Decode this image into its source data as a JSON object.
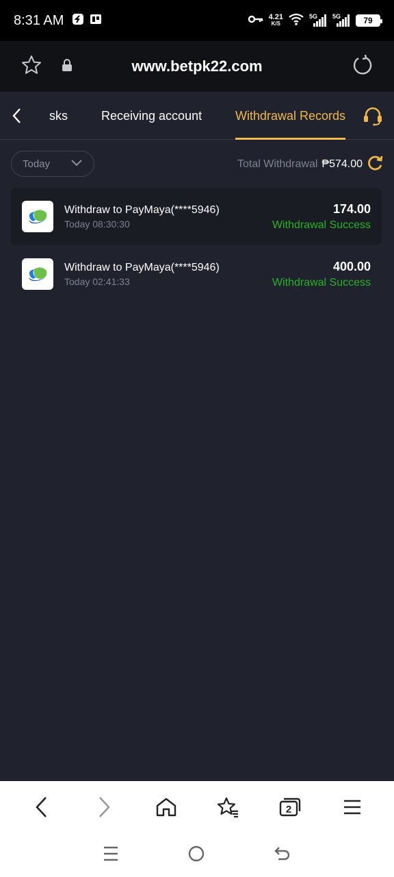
{
  "status": {
    "time": "8:31 AM",
    "speed_value": "4.21",
    "speed_unit": "K/S",
    "sim1": "5G",
    "sim2": "5G",
    "battery": "79"
  },
  "browser": {
    "url": "www.betpk22.com",
    "icons": [
      "star-icon",
      "lock-icon",
      "reload-icon"
    ]
  },
  "tabs": {
    "items": [
      "sks",
      "Receiving account",
      "Withdrawal Records"
    ],
    "active": "Withdrawal Records"
  },
  "filter": {
    "period": "Today",
    "total_label": "Total Withdrawal",
    "total_amount": "₱574.00"
  },
  "records": [
    {
      "title": "Withdraw to PayMaya(****5946)",
      "time": "Today 08:30:30",
      "amount": "174.00",
      "status": "Withdrawal Success"
    },
    {
      "title": "Withdraw to PayMaya(****5946)",
      "time": "Today 02:41:33",
      "amount": "400.00",
      "status": "Withdrawal Success"
    }
  ],
  "bottom_nav": {
    "tab_count": "2",
    "icons": [
      "back-icon",
      "forward-icon",
      "home-icon",
      "bookmarks-icon",
      "tabs-icon",
      "menu-icon"
    ]
  },
  "colors": {
    "accent": "#f0b84a",
    "success": "#27b327",
    "background": "#20232d"
  }
}
